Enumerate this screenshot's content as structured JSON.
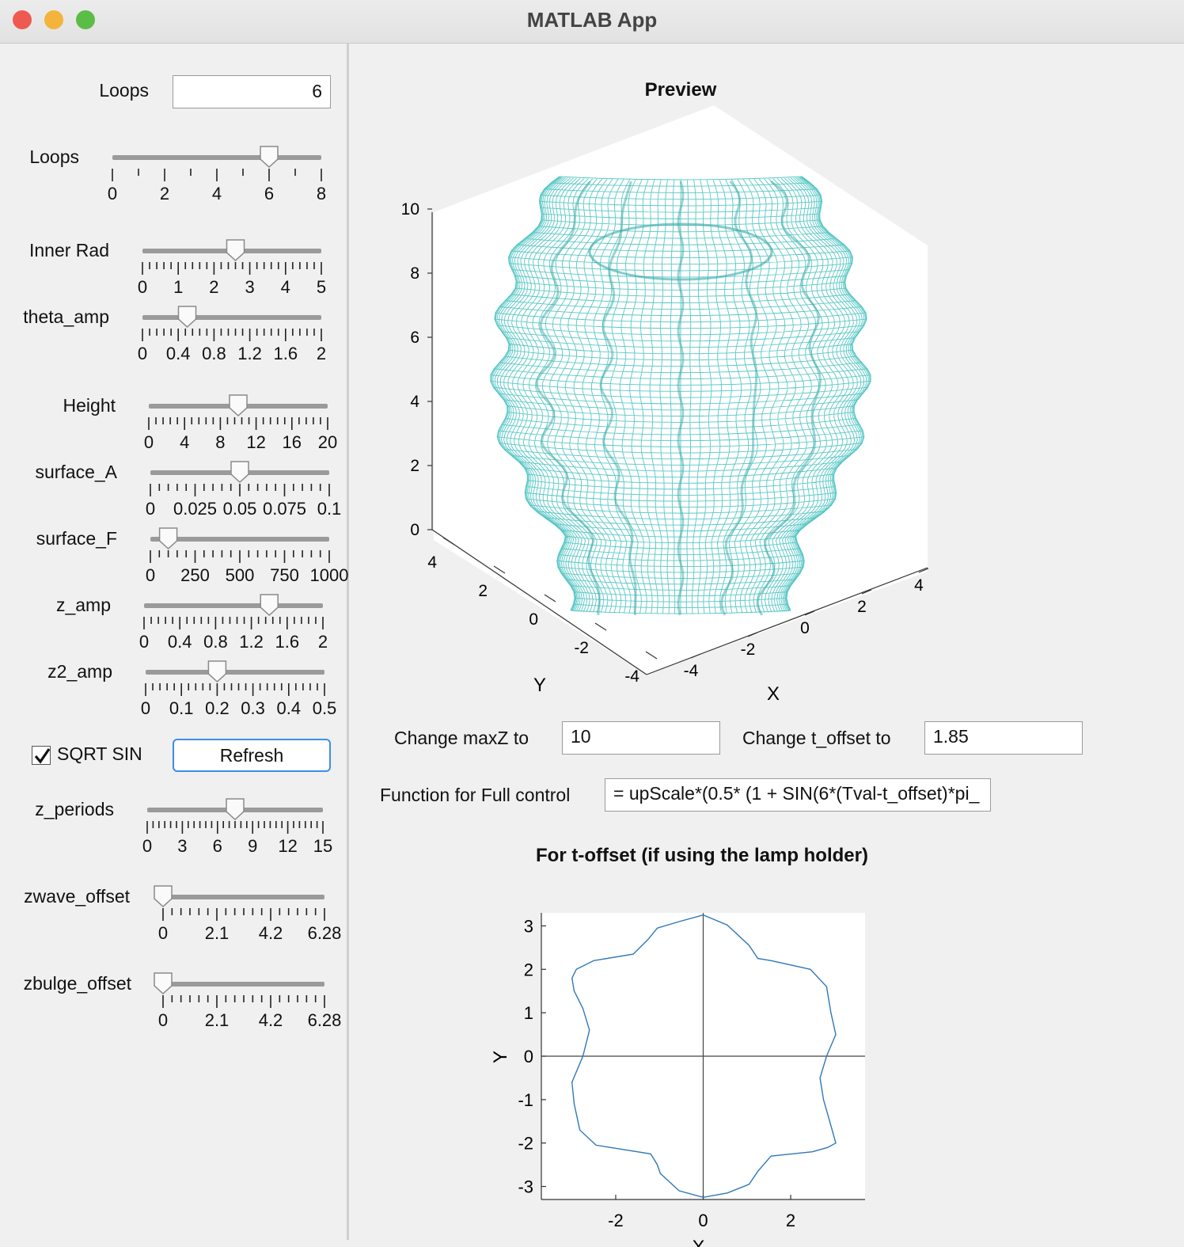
{
  "window": {
    "title": "MATLAB App",
    "close_color": "#ee5a52",
    "minimize_color": "#f4b33b",
    "zoom_color": "#5bbd45"
  },
  "controls": {
    "loops_field_label": "Loops",
    "loops_field_value": "6",
    "sliders": [
      {
        "label": "Loops",
        "value": 6,
        "min": 0,
        "max": 8,
        "ticks": [
          "0",
          "2",
          "4",
          "6",
          "8"
        ],
        "minor": 8
      },
      {
        "label": "Inner Rad",
        "value": 2.6,
        "min": 0,
        "max": 5,
        "ticks": [
          "0",
          "1",
          "2",
          "3",
          "4",
          "5"
        ],
        "minor": 25
      },
      {
        "label": "theta_amp",
        "value": 0.5,
        "min": 0,
        "max": 2,
        "ticks": [
          "0",
          "0.4",
          "0.8",
          "1.2",
          "1.6",
          "2"
        ],
        "minor": 25
      },
      {
        "label": "Height",
        "value": 10,
        "min": 0,
        "max": 20,
        "ticks": [
          "0",
          "4",
          "8",
          "12",
          "16",
          "20"
        ],
        "minor": 25
      },
      {
        "label": "surface_A",
        "value": 0.05,
        "min": 0,
        "max": 0.1,
        "ticks": [
          "0",
          "0.025",
          "0.05",
          "0.075",
          "0.1"
        ],
        "minor": 20
      },
      {
        "label": "surface_F",
        "value": 100,
        "min": 0,
        "max": 1000,
        "ticks": [
          "0",
          "250",
          "500",
          "750",
          "1000"
        ],
        "minor": 20
      },
      {
        "label": "z_amp",
        "value": 1.4,
        "min": 0,
        "max": 2,
        "ticks": [
          "0",
          "0.4",
          "0.8",
          "1.2",
          "1.6",
          "2"
        ],
        "minor": 25
      },
      {
        "label": "z2_amp",
        "value": 0.2,
        "min": 0,
        "max": 0.5,
        "ticks": [
          "0",
          "0.1",
          "0.2",
          "0.3",
          "0.4",
          "0.5"
        ],
        "minor": 25
      },
      {
        "label": "z_periods",
        "value": 7.5,
        "min": 0,
        "max": 15,
        "ticks": [
          "0",
          "3",
          "6",
          "9",
          "12",
          "15"
        ],
        "minor": 30
      },
      {
        "label": "zwave_offset",
        "value": 0,
        "min": 0,
        "max": 6.28,
        "ticks": [
          "0",
          "2.1",
          "4.2",
          "6.28"
        ],
        "minor": 18
      },
      {
        "label": "zbulge_offset",
        "value": 0,
        "min": 0,
        "max": 6.28,
        "ticks": [
          "0",
          "2.1",
          "4.2",
          "6.28"
        ],
        "minor": 18
      }
    ],
    "sqrt_sin_label": "SQRT SIN",
    "sqrt_sin_checked": true,
    "refresh_label": "Refresh"
  },
  "preview": {
    "title": "Preview",
    "mesh_color": "#4fc4c2",
    "z_ticks": [
      "0",
      "2",
      "4",
      "6",
      "8",
      "10"
    ],
    "y_ticks": [
      "4",
      "2",
      "0",
      "-2",
      "-4"
    ],
    "x_ticks": [
      "-4",
      "-2",
      "0",
      "2",
      "4"
    ],
    "ylabel": "Y",
    "xlabel": "X"
  },
  "fields": {
    "maxz_label": "Change maxZ to",
    "maxz_value": "10",
    "toffset_label": "Change t_offset to",
    "toffset_value": "1.85",
    "function_label": "Function for Full control",
    "function_value": "= upScale*(0.5* (1 + SIN(6*(Tval-t_offset)*pi_"
  },
  "chart_data": {
    "type": "line",
    "title": "For t-offset (if using the lamp holder)",
    "xlabel": "X",
    "ylabel": "Y",
    "xlim": [
      -3.7,
      3.7
    ],
    "ylim": [
      -3.3,
      3.3
    ],
    "x_ticks": [
      "-2",
      "0",
      "2"
    ],
    "y_ticks": [
      "3",
      "2",
      "1",
      "0",
      "-1",
      "-2",
      "-3"
    ],
    "line_color": "#2f78b7",
    "series": [
      {
        "name": "",
        "x": [
          0.0,
          0.55,
          1.05,
          1.25,
          1.55,
          2.45,
          2.82,
          2.92,
          3.03,
          2.82,
          2.67,
          2.75,
          2.92,
          3.03,
          2.85,
          2.5,
          1.55,
          1.25,
          1.05,
          0.55,
          0.0,
          -0.55,
          -0.98,
          -1.05,
          -1.2,
          -2.45,
          -2.82,
          -2.95,
          -3.0,
          -2.75,
          -2.6,
          -2.75,
          -2.95,
          -3.0,
          -2.9,
          -2.5,
          -1.6,
          -1.25,
          -1.05,
          -0.55,
          0.0
        ],
        "y": [
          3.25,
          3.02,
          2.55,
          2.25,
          2.2,
          2.0,
          1.6,
          1.0,
          0.5,
          0.0,
          -0.5,
          -1.0,
          -1.6,
          -2.0,
          -2.1,
          -2.2,
          -2.3,
          -2.65,
          -2.95,
          -3.15,
          -3.25,
          -3.1,
          -2.7,
          -2.5,
          -2.25,
          -2.05,
          -1.7,
          -1.1,
          -0.6,
          0.0,
          0.6,
          1.1,
          1.5,
          1.8,
          2.0,
          2.2,
          2.35,
          2.7,
          2.95,
          3.1,
          3.25
        ]
      }
    ]
  }
}
